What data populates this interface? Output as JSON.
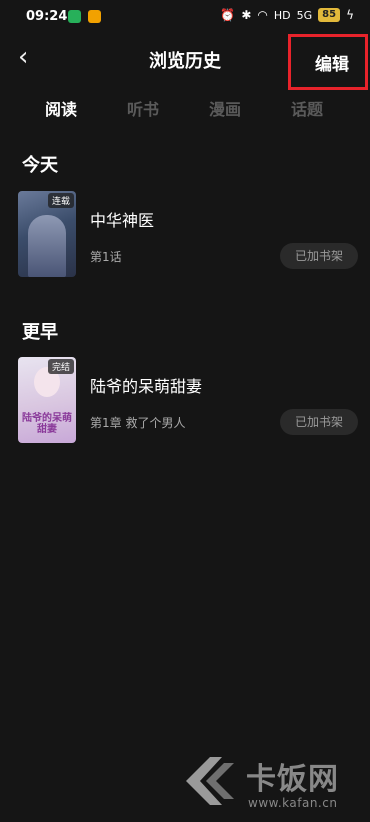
{
  "status_bar": {
    "time": "09:24",
    "network": "HD",
    "signal": "5G",
    "battery": "85"
  },
  "header": {
    "title": "浏览历史",
    "edit_label": "编辑"
  },
  "tabs": [
    {
      "label": "阅读",
      "active": true
    },
    {
      "label": "听书",
      "active": false
    },
    {
      "label": "漫画",
      "active": false
    },
    {
      "label": "话题",
      "active": false
    }
  ],
  "sections": [
    {
      "label": "今天",
      "items": [
        {
          "title": "中华神医",
          "badge": "连载",
          "chapter": "第1话",
          "action": "已加书架"
        }
      ]
    },
    {
      "label": "更早",
      "items": [
        {
          "title": "陆爷的呆萌甜妻",
          "badge": "完结",
          "chapter": "第1章 救了个男人",
          "action": "已加书架",
          "cover_text": "陆爷的呆萌甜妻"
        }
      ]
    }
  ],
  "watermark": {
    "name": "卡饭网",
    "url": "www.kafan.cn"
  }
}
